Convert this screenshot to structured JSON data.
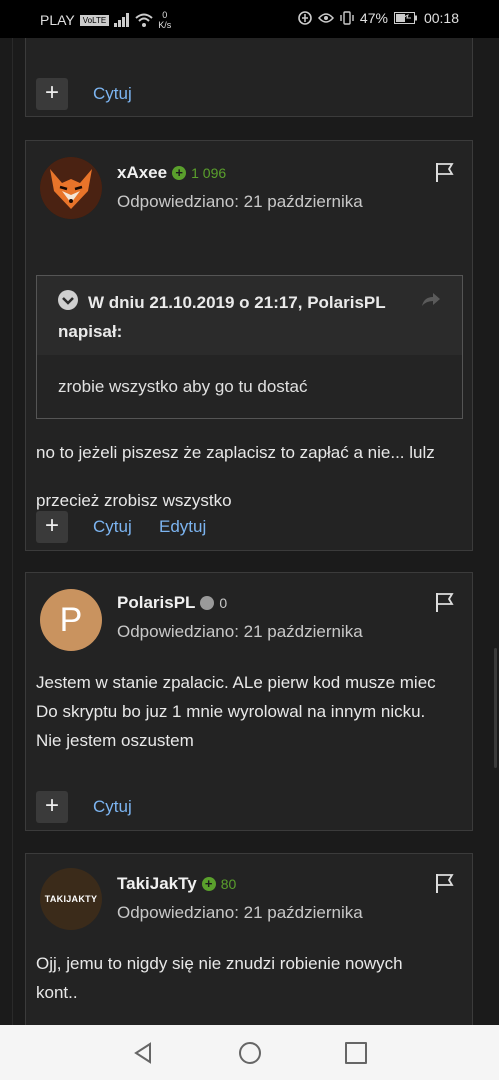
{
  "status_bar": {
    "carrier": "PLAY",
    "volte": "VoLTE",
    "speed_value": "0",
    "speed_unit": "K/s",
    "battery": "47%",
    "time": "00:18"
  },
  "posts": [
    {
      "actions": [
        "Cytuj"
      ]
    },
    {
      "author": "xAxee",
      "reputation": "1 096",
      "reputation_color": "#5aa02c",
      "date": "Odpowiedziano: 21 października",
      "quote": {
        "title_line1": "W dniu 21.10.2019 o 21:17, PolarisPL",
        "title_line2": "napisał:",
        "text": "zrobie wszystko aby go tu dostać"
      },
      "body": [
        "no to jeżeli piszesz że zaplacisz to zapłać a nie... lulz",
        "przecież zrobisz wszystko"
      ],
      "actions": [
        "Cytuj",
        "Edytuj"
      ]
    },
    {
      "author": "PolarisPL",
      "avatar_letter": "P",
      "avatar_color": "#c9935f",
      "reputation": "0",
      "reputation_color": "#9a9a9a",
      "date": "Odpowiedziano: 21 października",
      "body": [
        "Jestem w stanie zpalacic. ALe pierw kod musze miec",
        "Do skryptu bo juz 1 mnie wyrolowal na innym nicku.",
        "Nie jestem oszustem"
      ],
      "actions": [
        "Cytuj"
      ]
    },
    {
      "author": "TakiJakTy",
      "avatar_text": "TAKIJAKTY",
      "reputation": "80",
      "reputation_color": "#5aa02c",
      "date": "Odpowiedziano: 21 października",
      "body": [
        "Ojj, jemu to nigdy się nie znudzi robienie nowych",
        "kont.."
      ]
    }
  ],
  "colors": {
    "link": "#7cb4f0",
    "background": "#1b1b1b",
    "card": "#232323"
  }
}
